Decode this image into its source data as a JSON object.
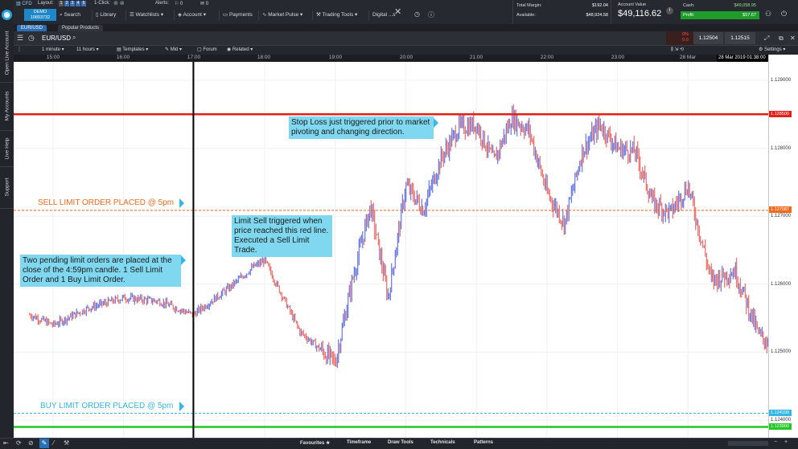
{
  "app": {
    "brand": "CFD",
    "layout_label": "Layout:",
    "layouts": [
      "1",
      "2",
      "3",
      "4",
      "5"
    ],
    "one_click_label": "1-Click:",
    "alerts_label": "Alerts:",
    "alerts_count_a": "0",
    "alerts_count_b": "0",
    "account_badge": "DEMO",
    "account_id": "10893732"
  },
  "nav": {
    "items": [
      "Search",
      "Library",
      "Watchlists",
      "Account",
      "Payments",
      "Market Pulse",
      "Trading Tools",
      "Digital ...s"
    ]
  },
  "stats": {
    "total_margin_label": "Total Margin:",
    "total_margin": "$192.04",
    "available_label": "Available:",
    "available": "$48,924.58",
    "account_value_label": "Account Value",
    "account_value": "$49,116.62",
    "cash_label": "Cash:",
    "cash": "$49,058.95",
    "profit_label": "Profit:",
    "profit": "$57.67"
  },
  "tabs": [
    "EUR/USD",
    "Popular Products"
  ],
  "chart_header": {
    "symbol": "EUR/USD",
    "change": "0%",
    "change_sub": "0.0",
    "bid": "1.12504",
    "ask": "1.12515"
  },
  "chart_toolbar": {
    "interval": "1 minute",
    "span": "11 hours",
    "templates": "Templates",
    "price_type": "Mid",
    "forum": "Forum",
    "related": "Related",
    "settings": "Settings"
  },
  "side_tabs": [
    "Open Live Account",
    "My Accounts",
    "Live Help",
    "Support"
  ],
  "time_ticks": [
    "15:00",
    "16:00",
    "17:00",
    "18:00",
    "19:00",
    "20:00",
    "21:00",
    "22:00",
    "23:00",
    "28 Mar"
  ],
  "crosshair_time": "28 Mar 2019 01:38:00",
  "price_ticks": [
    "1.129000",
    "1.128000",
    "1.127000",
    "1.126000",
    "1.125000",
    "1.124000"
  ],
  "price_tags": {
    "stop_loss": "1.128500",
    "sell_limit": "1.127087",
    "buy_limit": "1.124100",
    "green": "1.123900"
  },
  "annotations": {
    "stop_loss": "Stop Loss just triggered prior to market pivoting and changing direction.",
    "sell_limit_label": "SELL LIMIT ORDER PLACED @ 5pm",
    "limit_sell": "Limit Sell triggered when price reached this red line. Executed a Sell Limit Trade.",
    "two_pending": "Two pending limit orders are placed at the close of the 4:59pm candle. 1 Sell Limit Order and 1 Buy Limit Order.",
    "buy_limit_label": "BUY LIMIT ORDER PLACED @ 5pm"
  },
  "bottom_tabs": [
    "Favourites",
    "Timeframe",
    "Draw Tools",
    "Technicals",
    "Patterns"
  ],
  "colors": {
    "stop_loss": "#e0201a",
    "sell_limit": "#f06a1e",
    "buy_limit": "#35b7e6",
    "green_line": "#22c822",
    "candle_up": "#4a5bd8",
    "candle_down": "#e8504a",
    "annotation": "#7fd8ef"
  },
  "chart_data": {
    "type": "candlestick",
    "symbol": "EUR/USD",
    "interval": "1 minute",
    "x_range": [
      "14:40",
      "01:38"
    ],
    "y_range": [
      1.1238,
      1.1296
    ],
    "close_path": [
      {
        "t": "14:40",
        "p": 1.12555
      },
      {
        "t": "15:00",
        "p": 1.1254
      },
      {
        "t": "15:30",
        "p": 1.12565
      },
      {
        "t": "16:00",
        "p": 1.1258
      },
      {
        "t": "16:30",
        "p": 1.12575
      },
      {
        "t": "16:59",
        "p": 1.12555
      },
      {
        "t": "17:30",
        "p": 1.12595
      },
      {
        "t": "17:50",
        "p": 1.12625
      },
      {
        "t": "18:00",
        "p": 1.12635
      },
      {
        "t": "18:30",
        "p": 1.1253
      },
      {
        "t": "19:00",
        "p": 1.12485
      },
      {
        "t": "19:15",
        "p": 1.1261
      },
      {
        "t": "19:30",
        "p": 1.12715
      },
      {
        "t": "19:45",
        "p": 1.1258
      },
      {
        "t": "20:00",
        "p": 1.12745
      },
      {
        "t": "20:15",
        "p": 1.1271
      },
      {
        "t": "20:30",
        "p": 1.12785
      },
      {
        "t": "20:45",
        "p": 1.1283
      },
      {
        "t": "21:00",
        "p": 1.12835
      },
      {
        "t": "21:15",
        "p": 1.1278
      },
      {
        "t": "21:30",
        "p": 1.12845
      },
      {
        "t": "21:45",
        "p": 1.12825
      },
      {
        "t": "22:00",
        "p": 1.12735
      },
      {
        "t": "22:15",
        "p": 1.1269
      },
      {
        "t": "22:30",
        "p": 1.12795
      },
      {
        "t": "22:45",
        "p": 1.12835
      },
      {
        "t": "23:00",
        "p": 1.128
      },
      {
        "t": "23:15",
        "p": 1.12795
      },
      {
        "t": "23:30",
        "p": 1.1272
      },
      {
        "t": "23:45",
        "p": 1.12705
      },
      {
        "t": "24:00",
        "p": 1.12745
      },
      {
        "t": "24:20",
        "p": 1.12605
      },
      {
        "t": "24:40",
        "p": 1.1262
      },
      {
        "t": "25:00",
        "p": 1.12525
      },
      {
        "t": "25:15",
        "p": 1.12505
      },
      {
        "t": "25:25",
        "p": 1.1259
      },
      {
        "t": "25:38",
        "p": 1.1256
      }
    ]
  }
}
